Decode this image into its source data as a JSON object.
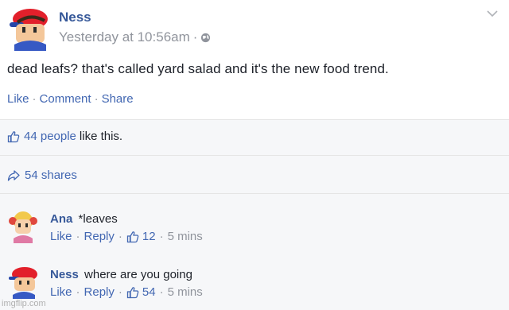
{
  "post": {
    "author": "Ness",
    "timestamp": "Yesterday at 10:56am",
    "separator": "·",
    "text": "dead leafs? that's called yard salad and it's the new food trend.",
    "actions": {
      "like": "Like",
      "comment": "Comment",
      "share": "Share",
      "dot": "·"
    }
  },
  "reactions": {
    "like_count": "44 people",
    "like_suffix": "like this."
  },
  "shares": {
    "label": "54 shares"
  },
  "comments": [
    {
      "name": "Ana",
      "text": "*leaves",
      "like": "Like",
      "reply": "Reply",
      "likes": "12",
      "time": "5 mins",
      "dot": "·"
    },
    {
      "name": "Ness",
      "text": "where are you going",
      "like": "Like",
      "reply": "Reply",
      "likes": "54",
      "time": "5 mins",
      "dot": "·"
    }
  ],
  "watermark": "imgflip.com",
  "colors": {
    "link": "#4267b2",
    "name": "#365899",
    "muted": "#90949c",
    "band": "#f6f7f9"
  },
  "icons": [
    "globe-icon",
    "chevron-down-icon",
    "thumbs-up-icon",
    "share-arrow-icon"
  ]
}
